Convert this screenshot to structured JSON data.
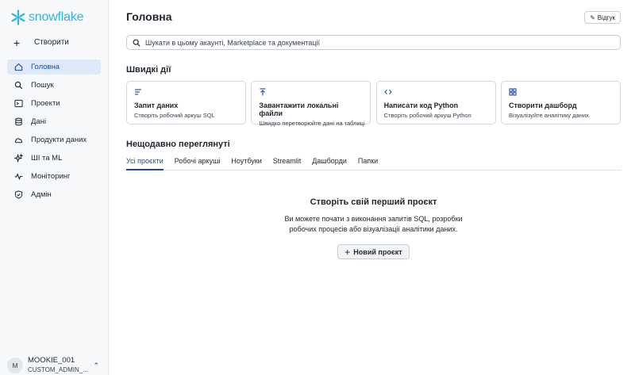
{
  "brand": {
    "name": "snowflake",
    "color": "#29b5e8"
  },
  "sidebar": {
    "create_label": "Створити",
    "items": [
      {
        "label": "Головна",
        "icon": "home-icon",
        "active": true
      },
      {
        "label": "Пошук",
        "icon": "search-icon"
      },
      {
        "label": "Проекти",
        "icon": "terminal-icon"
      },
      {
        "label": "Дані",
        "icon": "database-icon"
      },
      {
        "label": "Продукти даних",
        "icon": "cloud-icon"
      },
      {
        "label": "ШІ та ML",
        "icon": "sparkle-icon"
      },
      {
        "label": "Моніторинг",
        "icon": "activity-icon"
      },
      {
        "label": "Адмін",
        "icon": "shield-icon"
      }
    ],
    "user": {
      "initial": "M",
      "name": "MOOKIE_001",
      "role": "CUSTOM_ADMIN_..."
    }
  },
  "header": {
    "title": "Головна",
    "feedback_label": "Відгук"
  },
  "search": {
    "placeholder": "Шукати в цьому акаунті, Marketplace та документації"
  },
  "quick_actions": {
    "title": "Швидкі дії",
    "cards": [
      {
        "title": "Запит даних",
        "desc": "Створіть робочий аркуш SQL",
        "icon": "lines-icon"
      },
      {
        "title": "Завантажити локальні файли",
        "desc": "Швидко перетворюйте дані на таблиці",
        "icon": "upload-icon"
      },
      {
        "title": "Написати код Python",
        "desc": "Створіть робочий аркуш Python",
        "icon": "code-icon"
      },
      {
        "title": "Створити дашборд",
        "desc": "Візуалізуйте аналітику даних",
        "icon": "dashboard-icon"
      }
    ]
  },
  "recent": {
    "title": "Нещодавно переглянуті",
    "tabs": [
      "Усі проєкти",
      "Робочі аркуші",
      "Ноутбуки",
      "Streamlit",
      "Дашборди",
      "Папки"
    ],
    "active_tab": 0,
    "empty_title": "Створіть свій перший проєкт",
    "empty_desc_1": "Ви можете почати з виконання запитів SQL, розробки",
    "empty_desc_2": "робочих процесів або візуалізації аналітики даних.",
    "new_project_label": "Новий проєкт"
  },
  "colors": {
    "accent": "#1e4a9c",
    "active_bg": "#dde8f8"
  }
}
